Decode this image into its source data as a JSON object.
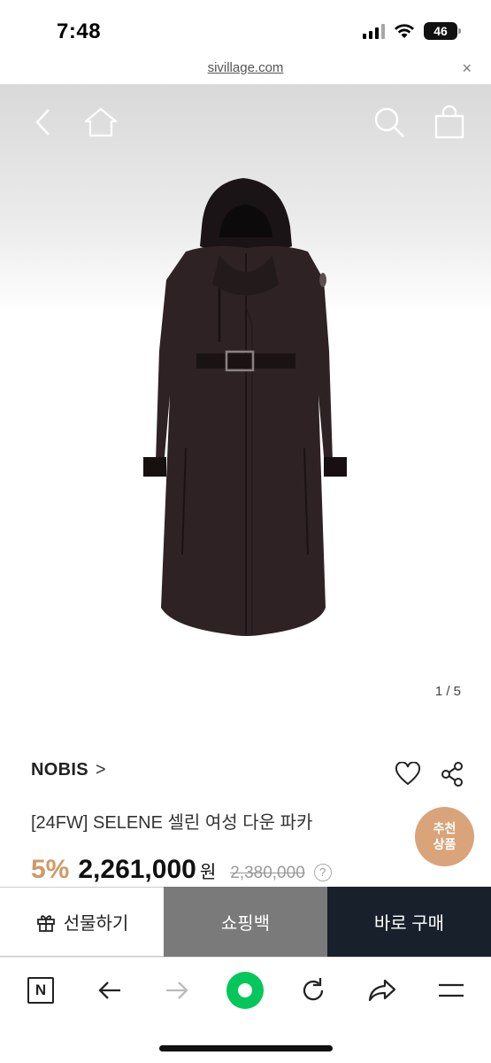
{
  "status_bar": {
    "time": "7:48",
    "battery": "46"
  },
  "browser": {
    "url": "sivillage.com",
    "close_label": "×"
  },
  "image_counter": "1 / 5",
  "product": {
    "brand": "NOBIS",
    "brand_chevron": ">",
    "title": "[24FW] SELENE 셀린 여성 다운 파카",
    "discount": "5%",
    "price": "2,261,000",
    "currency": "원",
    "original_price": "2,380,000",
    "help": "?"
  },
  "recommend_badge": {
    "line1": "추천",
    "line2": "상품"
  },
  "actions": {
    "gift": "선물하기",
    "bag": "쇼핑백",
    "buy": "바로 구매"
  },
  "toolbar": {
    "n_label": "N"
  },
  "colors": {
    "accent": "#d19866",
    "badge": "#d9a47a",
    "bag_button": "#7a7a7a",
    "buy_button": "#17202b",
    "naver_green": "#03c75a"
  },
  "icons": [
    "back-icon",
    "home-icon",
    "search-icon",
    "shopping-bag-icon",
    "heart-icon",
    "share-icon",
    "gift-icon",
    "naver-n-icon",
    "arrow-left-icon",
    "arrow-right-icon",
    "green-dot-icon",
    "reload-icon",
    "share-arrow-icon",
    "menu-icon"
  ]
}
